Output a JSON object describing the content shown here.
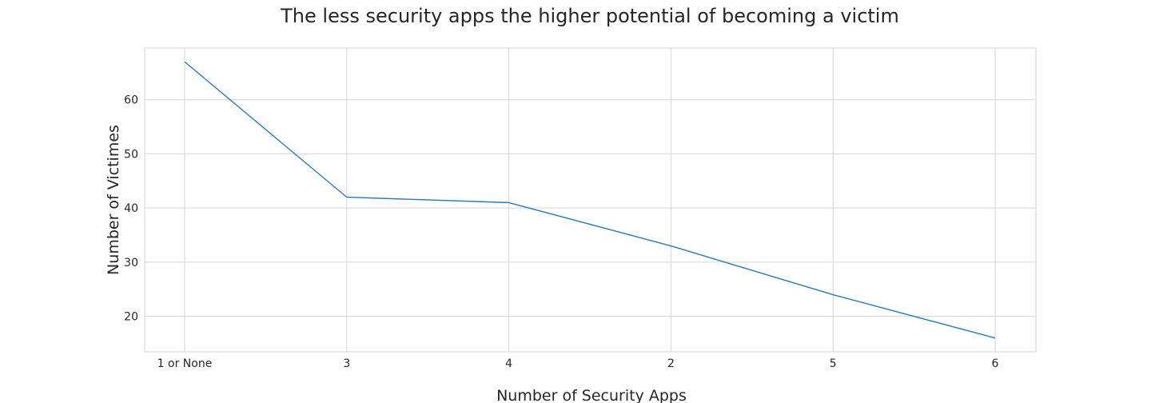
{
  "chart_data": {
    "type": "line",
    "title": "The less security apps the higher potential of becoming a victim",
    "xlabel": "Number of Security Apps",
    "ylabel": "Number of Victimes",
    "categories": [
      "1 or None",
      "3",
      "4",
      "2",
      "5",
      "6"
    ],
    "values": [
      67,
      42,
      41,
      33,
      24,
      16
    ],
    "ylim": [
      13.45,
      69.55
    ],
    "yticks": [
      20,
      30,
      40,
      50,
      60
    ],
    "grid": true,
    "legend": "none",
    "line_color": "#2b7bb4"
  }
}
